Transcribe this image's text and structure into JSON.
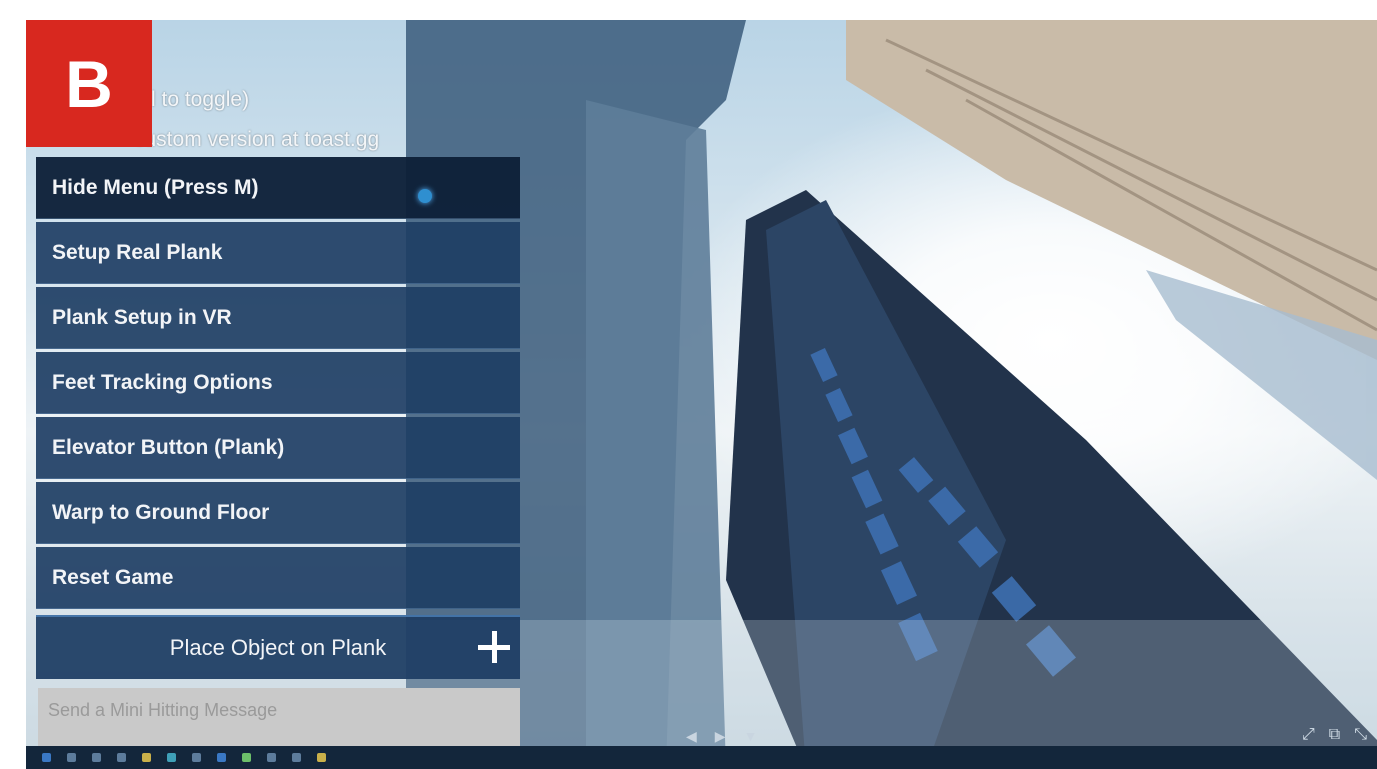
{
  "badge": {
    "letter": "B"
  },
  "overlay": {
    "line1": "l to toggle)",
    "line2": "custom version at toast.gg"
  },
  "menu": {
    "items": [
      {
        "label": "Hide Menu (Press M)",
        "active": true
      },
      {
        "label": "Setup Real Plank"
      },
      {
        "label": "Plank Setup in VR"
      },
      {
        "label": "Feet Tracking Options"
      },
      {
        "label": "Elevator Button (Plank)"
      },
      {
        "label": "Warp to Ground Floor"
      },
      {
        "label": "Reset Game"
      }
    ],
    "place_button": "Place Object on Plank"
  },
  "message": {
    "placeholder": "Send a Mini Hitting Message"
  },
  "media": {
    "prev": "◀",
    "play": "▶",
    "next": "▼"
  },
  "corner": {
    "a": "⤢",
    "b": "⧉",
    "c": "⤡"
  },
  "colors": {
    "menu_bg": "#1e3e64",
    "badge": "#d8281f",
    "accent": "#2f8fd0"
  }
}
